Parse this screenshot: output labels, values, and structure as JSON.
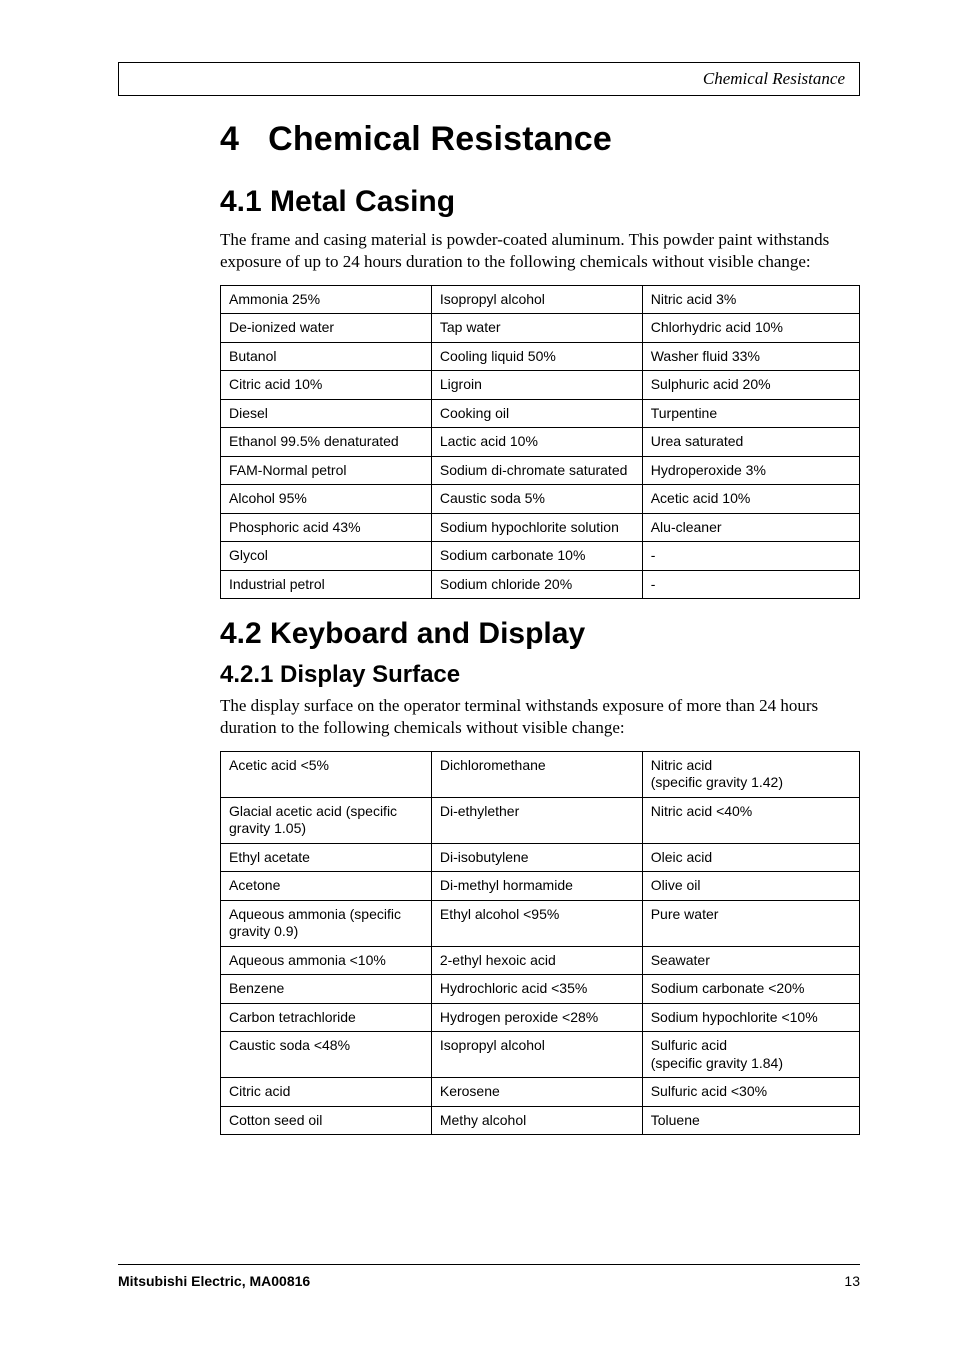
{
  "header": {
    "running_title": "Chemical Resistance"
  },
  "chapter": {
    "number": "4",
    "title": "Chemical Resistance"
  },
  "section_4_1": {
    "heading": "4.1  Metal Casing",
    "paragraph": "The frame and casing material is powder-coated aluminum. This powder paint withstands exposure of up to 24 hours duration to the following chemicals without visible change:",
    "table": [
      [
        "Ammonia 25%",
        "Isopropyl alcohol",
        "Nitric acid 3%"
      ],
      [
        "De-ionized water",
        "Tap water",
        "Chlorhydric acid 10%"
      ],
      [
        "Butanol",
        "Cooling liquid 50%",
        "Washer fluid 33%"
      ],
      [
        "Citric acid 10%",
        "Ligroin",
        "Sulphuric acid 20%"
      ],
      [
        "Diesel",
        "Cooking oil",
        "Turpentine"
      ],
      [
        "Ethanol 99.5% denaturated",
        "Lactic acid 10%",
        "Urea saturated"
      ],
      [
        "FAM-Normal petrol",
        "Sodium di-chromate saturated",
        "Hydroperoxide 3%"
      ],
      [
        "Alcohol 95%",
        "Caustic soda 5%",
        "Acetic acid 10%"
      ],
      [
        "Phosphoric acid 43%",
        "Sodium hypochlorite solution",
        "Alu-cleaner"
      ],
      [
        "Glycol",
        "Sodium carbonate 10%",
        "-"
      ],
      [
        "Industrial petrol",
        "Sodium chloride 20%",
        "-"
      ]
    ]
  },
  "section_4_2": {
    "heading": "4.2  Keyboard and Display",
    "sub_4_2_1": {
      "heading": "4.2.1  Display Surface",
      "paragraph": "The display surface on the operator terminal withstands exposure of more than 24 hours duration to the following chemicals without visible change:",
      "table": [
        [
          "Acetic acid <5%",
          "Dichloromethane",
          "Nitric acid\n(specific gravity 1.42)"
        ],
        [
          "Glacial acetic acid (specific gravity 1.05)",
          "Di-ethylether",
          "Nitric acid <40%"
        ],
        [
          "Ethyl acetate",
          "Di-isobutylene",
          "Oleic acid"
        ],
        [
          "Acetone",
          "Di-methyl hormamide",
          "Olive oil"
        ],
        [
          "Aqueous ammonia (specific gravity 0.9)",
          "Ethyl alcohol <95%",
          "Pure water"
        ],
        [
          "Aqueous ammonia <10%",
          "2-ethyl hexoic acid",
          "Seawater"
        ],
        [
          "Benzene",
          "Hydrochloric acid <35%",
          "Sodium carbonate <20%"
        ],
        [
          "Carbon tetrachloride",
          "Hydrogen peroxide <28%",
          "Sodium hypochlorite <10%"
        ],
        [
          "Caustic soda <48%",
          "Isopropyl alcohol",
          "Sulfuric acid\n(specific gravity 1.84)"
        ],
        [
          "Citric acid",
          "Kerosene",
          "Sulfuric acid <30%"
        ],
        [
          "Cotton seed oil",
          "Methy alcohol",
          "Toluene"
        ]
      ]
    }
  },
  "footer": {
    "left": "Mitsubishi Electric, MA00816",
    "right": "13"
  }
}
